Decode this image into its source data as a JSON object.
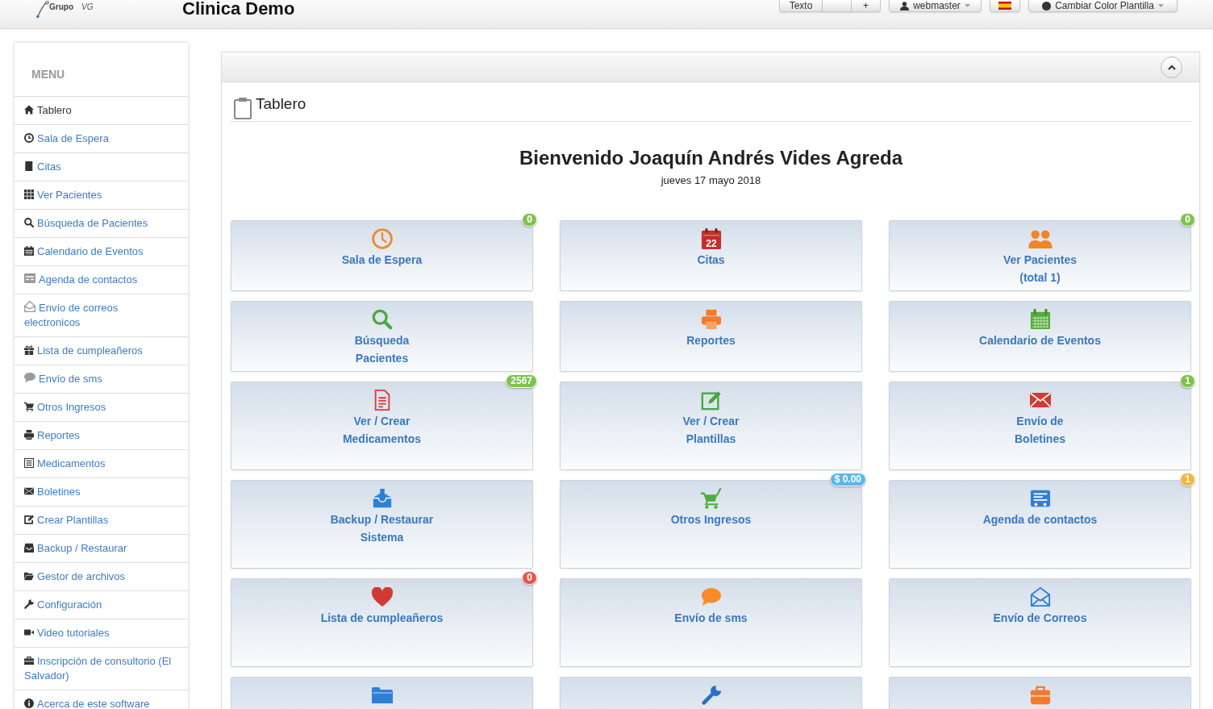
{
  "header": {
    "logo": {
      "line_1": "Grupo",
      "line_2": "VG"
    },
    "title": "Clinica Demo",
    "font_buttons": {
      "label": "Texto",
      "increase": "+"
    },
    "user_menu": {
      "label": "webmaster"
    },
    "theme_menu": {
      "label": "Cambiar Color Plantilla"
    }
  },
  "sidebar": {
    "title": "MENU",
    "items": [
      {
        "label": "Tablero",
        "selected": true
      },
      {
        "label": "Sala de Espera",
        "selected": false
      },
      {
        "label": "Citas",
        "selected": false
      },
      {
        "label": "Ver Pacientes",
        "selected": false
      },
      {
        "label": "Búsqueda de Pacientes",
        "selected": false
      },
      {
        "label": "Calendario de Eventos",
        "selected": false
      },
      {
        "label": "Agenda de contactos",
        "selected": false
      },
      {
        "label": "Envío de correos electronicos",
        "selected": false
      },
      {
        "label": "Lista de cumpleañeros",
        "selected": false
      },
      {
        "label": "Envío de sms",
        "selected": false
      },
      {
        "label": "Otros Ingresos",
        "selected": false
      },
      {
        "label": "Reportes",
        "selected": false
      },
      {
        "label": "Medicamentos",
        "selected": false
      },
      {
        "label": "Boletines",
        "selected": false
      },
      {
        "label": "Crear Plantillas",
        "selected": false
      },
      {
        "label": "Backup / Restaurar",
        "selected": false
      },
      {
        "label": "Gestor de archivos",
        "selected": false
      },
      {
        "label": "Configuración",
        "selected": false
      },
      {
        "label": "Video tutoriales",
        "selected": false
      },
      {
        "label": "Inscripción de consultorio (El Salvador)",
        "selected": false
      },
      {
        "label": "Acerca de este software",
        "selected": false
      }
    ]
  },
  "dashboard": {
    "title": "Tablero",
    "welcome": "Bienvenido Joaquín Andrés Vides Agreda",
    "date": "jueves 17 mayo 2018",
    "tiles": [
      {
        "kind": "waiting",
        "label": "Sala de Espera",
        "badge": {
          "text": "0",
          "color": "#7cc34b"
        }
      },
      {
        "kind": "appointments",
        "label": "Citas",
        "icon_text": "22"
      },
      {
        "kind": "patients",
        "label": "Ver Pacientes\n(total 1)",
        "badge": {
          "text": "0",
          "color": "#7cc34b"
        }
      },
      {
        "kind": "search",
        "label": "Búsqueda\nPacientes"
      },
      {
        "kind": "reports",
        "label": "Reportes"
      },
      {
        "kind": "events",
        "label": "Calendario de Eventos"
      },
      {
        "kind": "medicines",
        "label": "Ver / Crear\nMedicamentos",
        "badge": {
          "text": "2567",
          "color": "#7cc34b"
        }
      },
      {
        "kind": "templates",
        "label": "Ver / Crear\nPlantillas"
      },
      {
        "kind": "newsletters",
        "label": "Envío de\nBoletines",
        "badge": {
          "text": "1",
          "color": "#7cc34b"
        }
      },
      {
        "kind": "backup",
        "label": "Backup / Restaurar\nSistema"
      },
      {
        "kind": "income",
        "label": "Otros Ingresos",
        "badge": {
          "text": "$ 0.00",
          "color": "#5db5ea"
        }
      },
      {
        "kind": "contacts",
        "label": "Agenda de contactos",
        "badge": {
          "text": "1",
          "color": "#f4b43e"
        }
      },
      {
        "kind": "birthdays",
        "label": "Lista de cumpleañeros",
        "badge": {
          "text": "0",
          "color": "#e9564b"
        }
      },
      {
        "kind": "sms",
        "label": "Envío de sms"
      },
      {
        "kind": "email",
        "label": "Envío de Correos"
      },
      {
        "kind": "files"
      },
      {
        "kind": "settings"
      },
      {
        "kind": "registration"
      }
    ]
  }
}
